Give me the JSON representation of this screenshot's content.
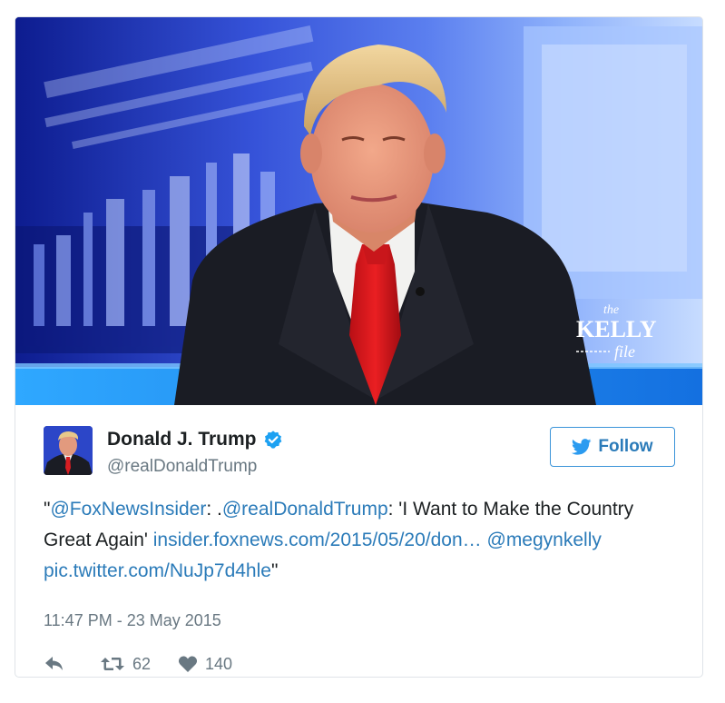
{
  "media": {
    "watermark_small": "the",
    "watermark_main": "KELLY",
    "watermark_sub": "file"
  },
  "author": {
    "name": "Donald J. Trump",
    "handle": "@realDonaldTrump"
  },
  "follow_button": {
    "label": "Follow"
  },
  "tweet": {
    "segments": [
      {
        "text": "\"",
        "link": false
      },
      {
        "text": "@FoxNewsInsider",
        "link": true
      },
      {
        "text": ": .",
        "link": false
      },
      {
        "text": "@realDonaldTrump",
        "link": true
      },
      {
        "text": ": 'I Want to Make the Country Great Again' ",
        "link": false
      },
      {
        "text": "insider.foxnews.com/2015/05/20/don…",
        "link": true
      },
      {
        "text": " ",
        "link": false
      },
      {
        "text": "@megynkelly",
        "link": true
      },
      {
        "text": " ",
        "link": false
      },
      {
        "text": "pic.twitter.com/NuJp7d4hle",
        "link": true
      },
      {
        "text": "\"",
        "link": false
      }
    ]
  },
  "timestamp": "11:47 PM - 23 May 2015",
  "actions": {
    "retweet_count": "62",
    "like_count": "140"
  },
  "colors": {
    "link": "#2b7bb9",
    "muted": "#697882",
    "text": "#1c2022",
    "verified": "#1da1f2"
  }
}
